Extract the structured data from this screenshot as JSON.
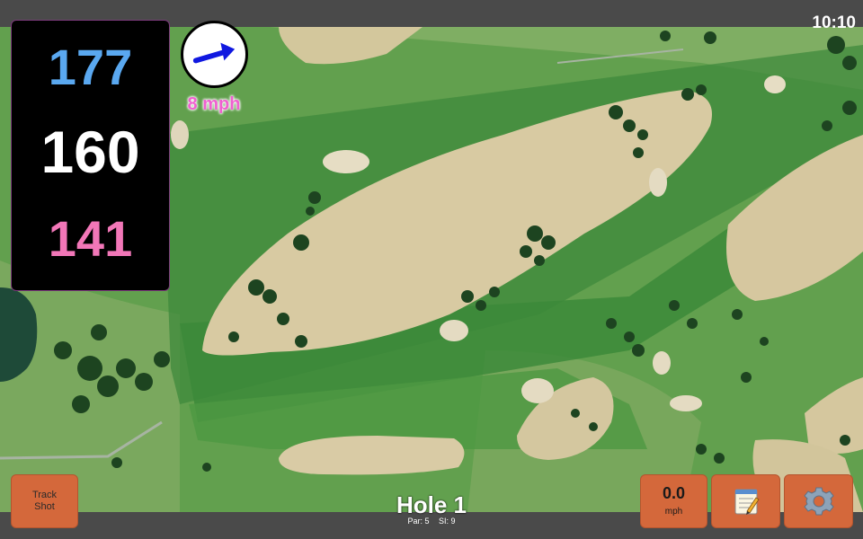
{
  "status_bar": {
    "time": "10:10"
  },
  "distances": {
    "back": "177",
    "center": "160",
    "front": "141"
  },
  "wind": {
    "speed": "8 mph",
    "icon": "wind-arrow-icon",
    "arrow_color": "#1018e0"
  },
  "hole": {
    "title": "Hole 1",
    "par": "Par: 5",
    "stroke_index": "SI: 9"
  },
  "buttons": {
    "track_shot": {
      "line1": "Track",
      "line2": "Shot"
    },
    "speed": {
      "value": "0.0",
      "unit": "mph"
    },
    "notes": {
      "icon": "notepad-icon"
    },
    "settings": {
      "icon": "gear-icon"
    }
  },
  "colors": {
    "button_bg": "#d4683b",
    "back_distance": "#5aa8f0",
    "center_distance": "#ffffff",
    "front_distance": "#f277b8",
    "wind_text": "#f060d0",
    "bar_bg": "#4a4a4a"
  }
}
